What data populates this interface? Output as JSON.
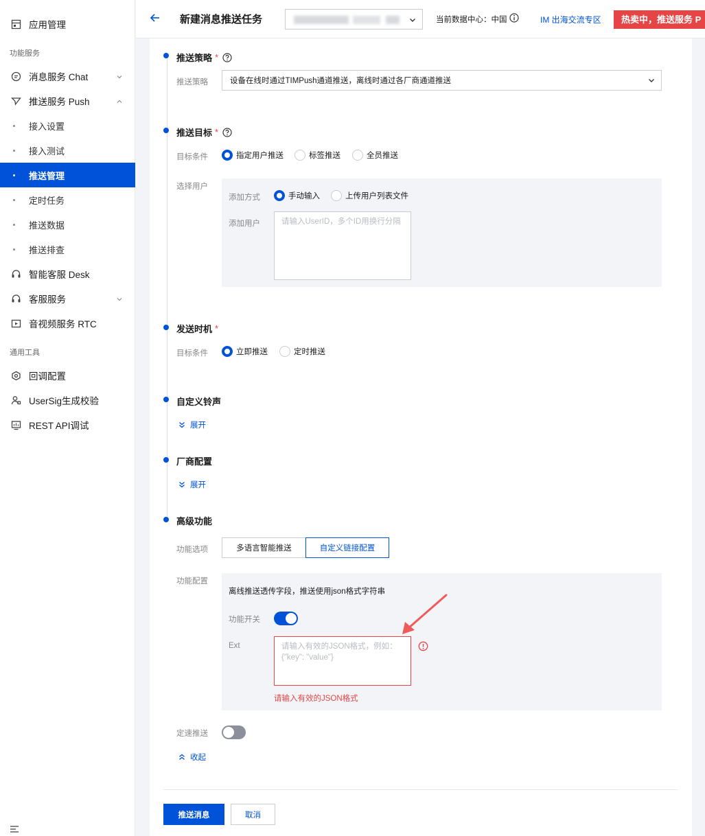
{
  "sidebar": {
    "app_mgmt": "应用管理",
    "group_func": "功能服务",
    "chat": "消息服务 Chat",
    "push": "推送服务 Push",
    "push_subs": [
      "接入设置",
      "接入测试",
      "推送管理",
      "定时任务",
      "推送数据",
      "推送排查"
    ],
    "desk": "智能客服 Desk",
    "kefu": "客服服务",
    "rtc": "音视频服务 RTC",
    "group_tools": "通用工具",
    "callback": "回调配置",
    "usersig": "UserSig生成校验",
    "rest": "REST API调试"
  },
  "header": {
    "title": "新建消息推送任务",
    "datacenter": "当前数据中心：中国",
    "im_link": "IM 出海交流专区",
    "promo": "热卖中，推送服务 P"
  },
  "strategy": {
    "title": "推送策略",
    "label": "推送策略",
    "value": "设备在线时通过TIMPush通道推送，离线时通过各厂商通道推送"
  },
  "target": {
    "title": "推送目标",
    "cond_label": "目标条件",
    "options": [
      "指定用户推送",
      "标签推送",
      "全员推送"
    ],
    "select_user_label": "选择用户",
    "add_method_label": "添加方式",
    "add_methods": [
      "手动输入",
      "上传用户列表文件"
    ],
    "add_user_label": "添加用户",
    "add_user_placeholder": "请输入UserID，多个ID用换行分隔"
  },
  "timing": {
    "title": "发送时机",
    "cond_label": "目标条件",
    "options": [
      "立即推送",
      "定时推送"
    ]
  },
  "ringtone": {
    "title": "自定义铃声",
    "expand": "展开"
  },
  "vendor": {
    "title": "厂商配置",
    "expand": "展开"
  },
  "advanced": {
    "title": "高级功能",
    "options_label": "功能选项",
    "tabs": [
      "多语言智能推送",
      "自定义链接配置"
    ],
    "config_label": "功能配置",
    "desc": "离线推送透传字段，推送使用json格式字符串",
    "switch_label": "功能开关",
    "switch_on": true,
    "ext_label": "Ext",
    "ext_placeholder_line1": "请输入有效的JSON格式，例如：",
    "ext_placeholder_line2": "{\"key\": \"value\"}",
    "ext_error": "请输入有效的JSON格式",
    "speed_label": "定速推送",
    "speed_on": false,
    "collapse": "收起"
  },
  "actions": {
    "submit": "推送消息",
    "cancel": "取消"
  },
  "colors": {
    "primary": "#0052d9",
    "danger": "#e54545",
    "panel": "#f3f4f7"
  }
}
